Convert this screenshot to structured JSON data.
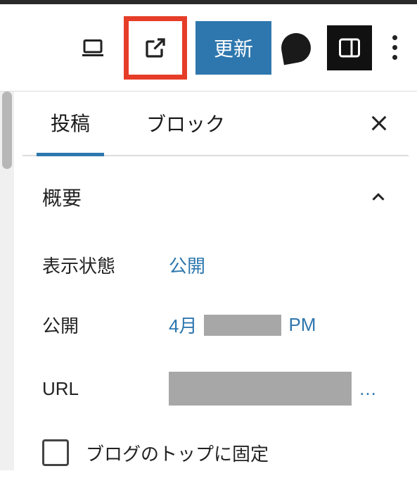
{
  "toolbar": {
    "update_label": "更新"
  },
  "tabs": {
    "post": "投稿",
    "block": "ブロック"
  },
  "summary": {
    "title": "概要",
    "visibility_label": "表示状態",
    "visibility_value": "公開",
    "publish_label": "公開",
    "publish_month": "4月",
    "publish_suffix": "PM",
    "url_label": "URL",
    "url_ellipsis": "…",
    "stick_label": "ブログのトップに固定"
  }
}
